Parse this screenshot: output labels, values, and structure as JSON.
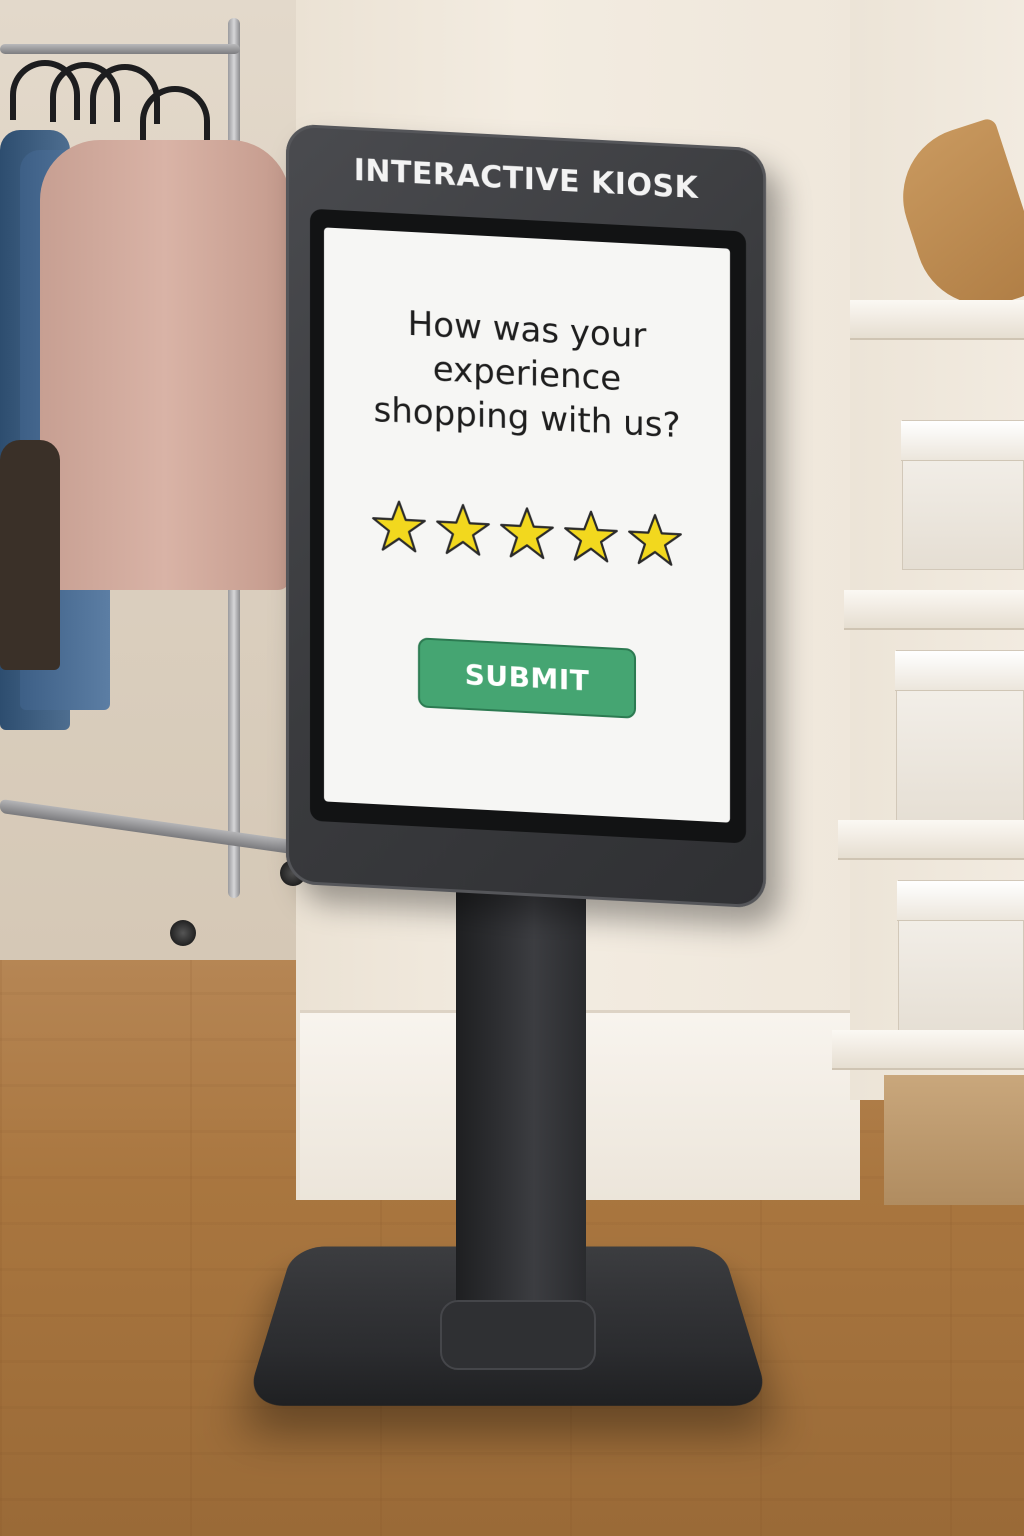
{
  "kiosk": {
    "title": "INTERACTIVE KIOSK",
    "screen": {
      "question": "How was your experience shopping with us?",
      "rating": {
        "max_stars": 5,
        "selected_stars": 5,
        "star_color": "#f2d81e",
        "star_outline_color": "#2a2a2a"
      },
      "submit_label": "SUBMIT",
      "submit_color": "#45a572"
    }
  }
}
